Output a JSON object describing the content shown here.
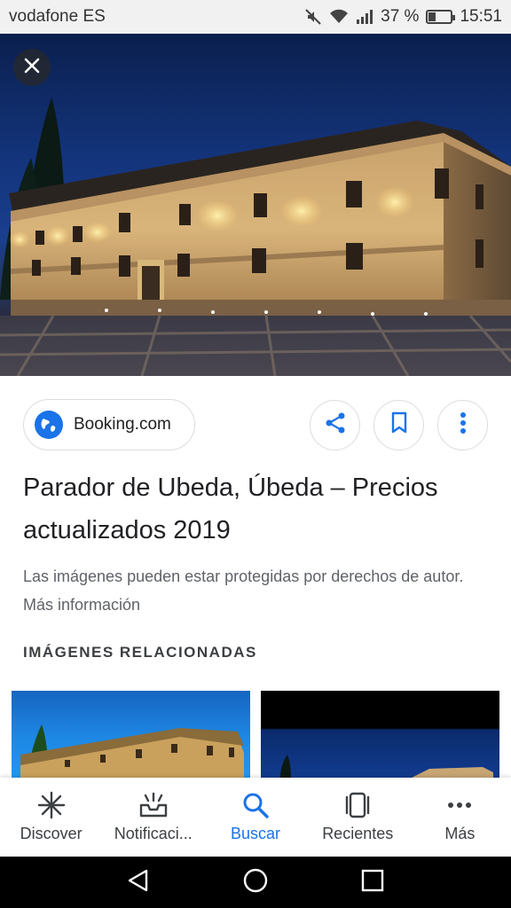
{
  "status_bar": {
    "carrier": "vodafone ES",
    "battery_text": "37 %",
    "time": "15:51",
    "battery_level": 0.37
  },
  "hero": {
    "close_icon": "close-icon"
  },
  "source": {
    "label": "Booking.com",
    "icon": "globe-icon"
  },
  "actions": [
    {
      "icon": "share-icon"
    },
    {
      "icon": "bookmark-icon"
    },
    {
      "icon": "more-vert-icon"
    }
  ],
  "result": {
    "title": "Parador de Ubeda, Úbeda – Precios actualizados 2019",
    "notice": "Las imágenes pueden estar protegidas por derechos de autor. Más información"
  },
  "related": {
    "heading": "IMÁGENES RELACIONADAS"
  },
  "bottom_nav": [
    {
      "label": "Discover",
      "icon": "asterisk-icon"
    },
    {
      "label": "Notificaci...",
      "icon": "inbox-notification-icon"
    },
    {
      "label": "Buscar",
      "icon": "search-icon",
      "active": true
    },
    {
      "label": "Recientes",
      "icon": "recent-cards-icon"
    },
    {
      "label": "Más",
      "icon": "more-horiz-icon"
    }
  ],
  "colors": {
    "accent": "#1a73e8",
    "text_primary": "#202124",
    "text_secondary": "#5f6368"
  }
}
